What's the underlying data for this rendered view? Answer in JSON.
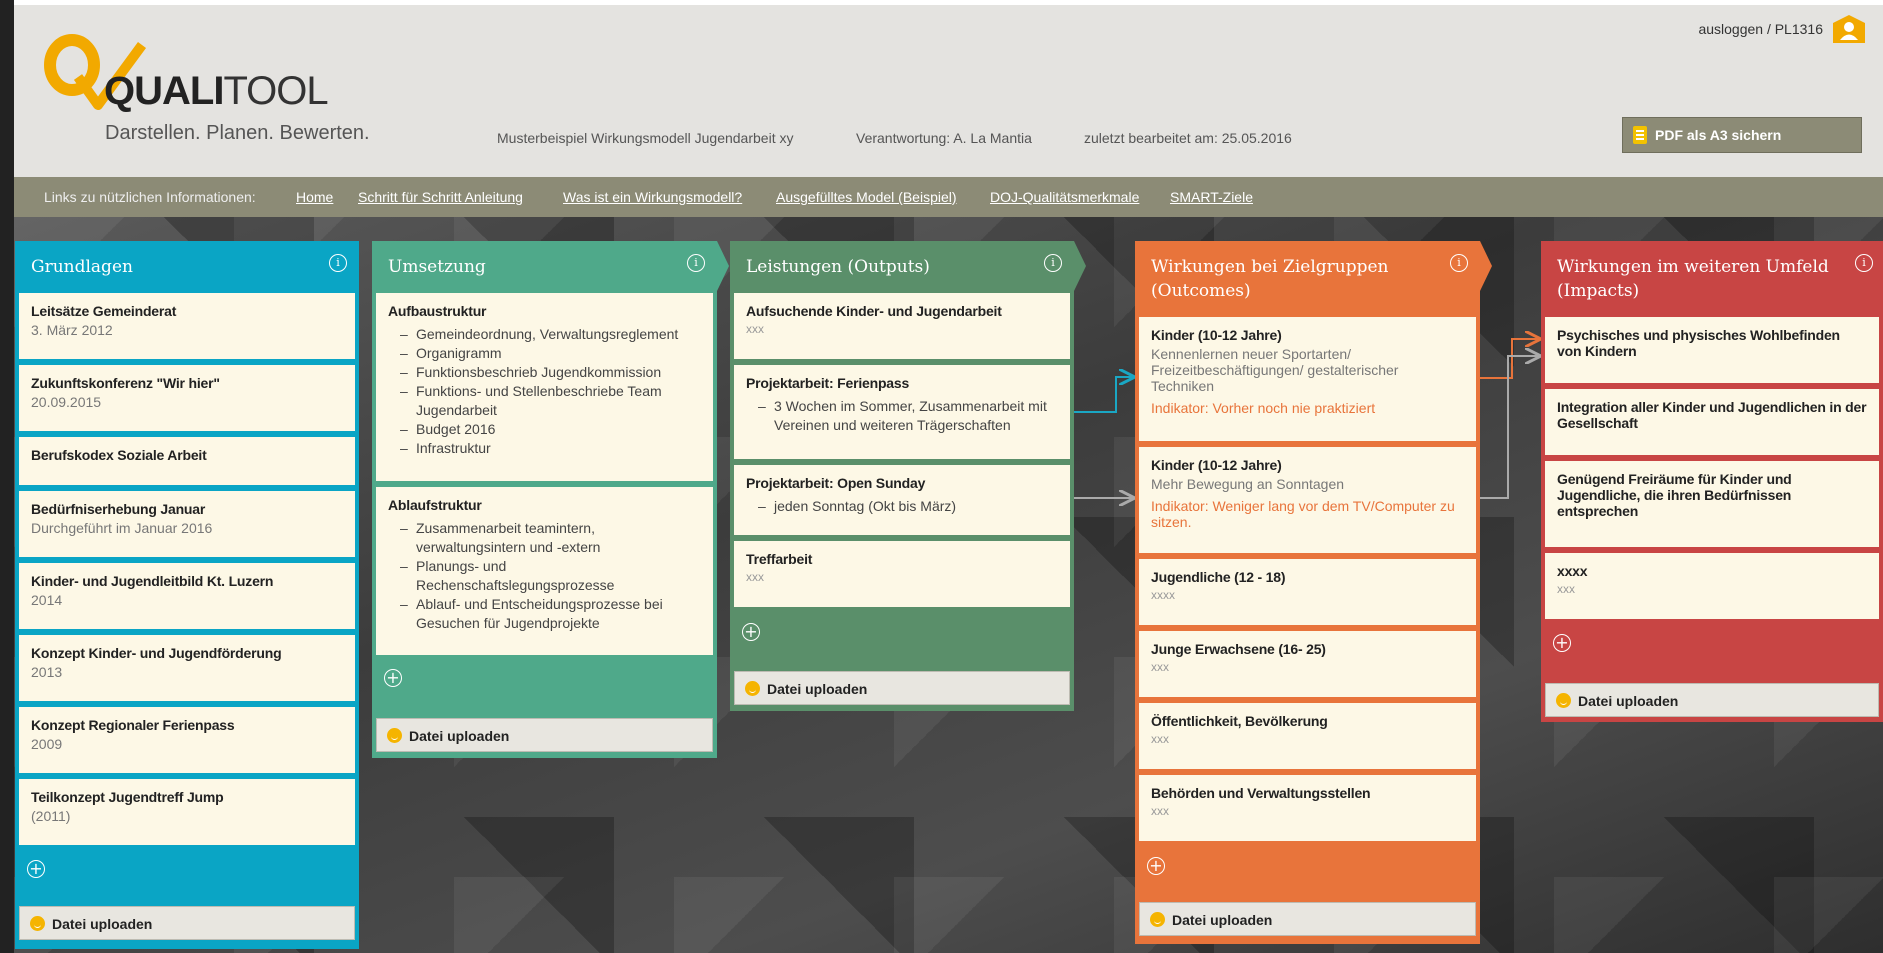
{
  "header": {
    "logo_word_bold": "QUALI",
    "logo_word_light": "TOOL",
    "tagline": "Darstellen. Planen. Bewerten.",
    "project": "Musterbeispiel Wirkungsmodell Jugendarbeit xy",
    "responsible": "Verantwortung: A. La Mantia",
    "last_edited": "zuletzt bearbeitet am: 25.05.2016",
    "logout": "ausloggen / PL1316",
    "pdf_button": "PDF als A3 sichern"
  },
  "linkbar": {
    "intro": "Links zu nützlichen Informationen:",
    "links": [
      "Home",
      "Schritt für Schritt Anleitung",
      "Was ist ein Wirkungsmodell?",
      "Ausgefülltes Model (Beispiel)",
      "DOJ-Qualitätsmerkmale",
      "SMART-Ziele"
    ]
  },
  "colors": {
    "grundlagen": "#0aa5c5",
    "umsetzung": "#4fa98a",
    "leistungen": "#5a8f6a",
    "wirkungen": "#e8743b",
    "impacts": "#c84544",
    "card": "#fdf8e6"
  },
  "columns": {
    "grundlagen": {
      "title": "Grundlagen",
      "cards": [
        {
          "title": "Leitsätze Gemeinderat",
          "sub": "3. März 2012"
        },
        {
          "title": "Zukunftskonferenz \"Wir hier\"",
          "sub": "20.09.2015"
        },
        {
          "title": "Berufskodex Soziale Arbeit",
          "sub": ""
        },
        {
          "title": "Bedürfniserhebung Januar",
          "sub": "Durchgeführt im Januar 2016"
        },
        {
          "title": "Kinder- und Jugendleitbild Kt. Luzern",
          "sub": "2014"
        },
        {
          "title": "Konzept Kinder- und Jugendförderung",
          "sub": "2013"
        },
        {
          "title": "Konzept Regionaler Ferienpass",
          "sub": "2009"
        },
        {
          "title": "Teilkonzept Jugendtreff Jump",
          "sub": "(2011)"
        }
      ],
      "upload": "Datei uploaden"
    },
    "umsetzung": {
      "title": "Umsetzung",
      "cards": [
        {
          "title": "Aufbaustruktur",
          "items": [
            "Gemeindeordnung, Verwaltungsreglement",
            "Organigramm",
            "Funktionsbeschrieb Jugendkommission",
            "Funktions- und Stellenbeschriebe Team Jugendarbeit",
            "Budget 2016",
            "Infrastruktur"
          ]
        },
        {
          "title": "Ablaufstruktur",
          "items": [
            "Zusammenarbeit teamintern, verwaltungsintern und -extern",
            "Planungs- und Rechenschaftslegungsprozesse",
            "Ablauf- und Entscheidungsprozesse bei Gesuchen für Jugendprojekte"
          ]
        }
      ],
      "upload": "Datei uploaden"
    },
    "leistungen": {
      "title": "Leistungen (Outputs)",
      "cards": [
        {
          "title": "Aufsuchende Kinder- und Jugendarbeit",
          "sub": "xxx"
        },
        {
          "title": "Projektarbeit: Ferienpass",
          "item": "3 Wochen im Sommer, Zusammenarbeit mit Vereinen und weiteren Trägerschaften"
        },
        {
          "title": "Projektarbeit: Open Sunday",
          "item": "jeden Sonntag (Okt bis März)"
        },
        {
          "title": "Treffarbeit",
          "sub": "xxx"
        }
      ],
      "upload": "Datei uploaden"
    },
    "wirkungen": {
      "title_line1": "Wirkungen bei Zielgruppen",
      "title_line2": "(Outcomes)",
      "cards": [
        {
          "title": "Kinder (10-12 Jahre)",
          "sub": "Kennenlernen neuer Sportarten/ Freizeitbeschäftigungen/ gestalterischer Techniken",
          "indicator": "Indikator: Vorher noch nie praktiziert"
        },
        {
          "title": "Kinder (10-12 Jahre)",
          "sub": "Mehr Bewegung an Sonntagen",
          "indicator": "Indikator: Weniger lang vor dem TV/Computer zu sitzen."
        },
        {
          "title": "Jugendliche (12 - 18)",
          "sub": "xxxx"
        },
        {
          "title": "Junge Erwachsene (16- 25)",
          "sub": "xxx"
        },
        {
          "title": "Öffentlichkeit, Bevölkerung",
          "sub": "xxx"
        },
        {
          "title": "Behörden und Verwaltungsstellen",
          "sub": "xxx"
        }
      ],
      "upload": "Datei uploaden"
    },
    "impacts": {
      "title_line1": "Wirkungen im weiteren Umfeld",
      "title_line2": "(Impacts)",
      "cards": [
        {
          "title": "Psychisches und physisches Wohlbefinden von Kindern"
        },
        {
          "title": "Integration aller Kinder und Jugendlichen in der Gesellschaft"
        },
        {
          "title": "Genügend Freiräume für Kinder und Jugendliche, die ihren Bedürfnissen entsprechen"
        },
        {
          "title": "xxxx",
          "sub": "xxx"
        }
      ],
      "upload": "Datei uploaden"
    }
  },
  "icons": {
    "info": "i",
    "add": "+"
  }
}
